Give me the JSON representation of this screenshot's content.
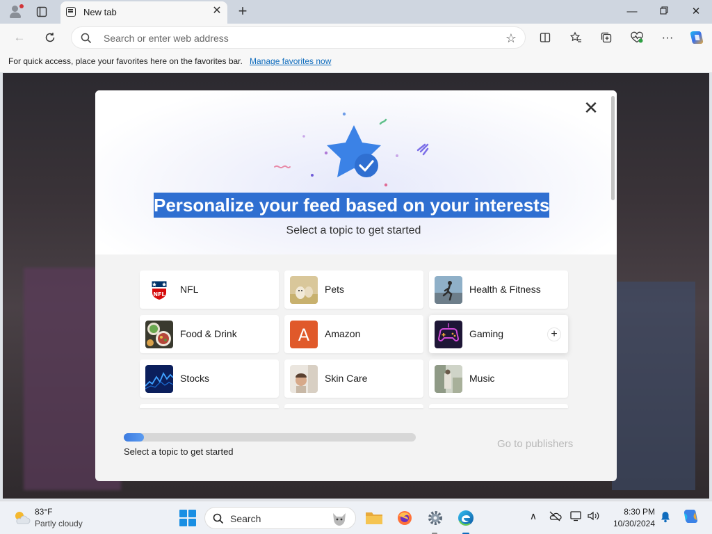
{
  "browser": {
    "tab": {
      "title": "New tab"
    },
    "address_bar": {
      "placeholder": "Search or enter web address"
    },
    "favorites_bar": {
      "message": "For quick access, place your favorites here on the favorites bar.",
      "link": "Manage favorites now"
    },
    "toolbar_icons": [
      "split-screen-icon",
      "favorites-icon",
      "collections-icon",
      "browser-essentials-icon",
      "more-icon",
      "copilot-icon"
    ]
  },
  "modal": {
    "title": "Personalize your feed based on your interests",
    "subtitle": "Select a topic to get started",
    "topics": [
      {
        "label": "NFL",
        "icon": "nfl-logo"
      },
      {
        "label": "Pets",
        "icon": "pets-thumbnail"
      },
      {
        "label": "Health & Fitness",
        "icon": "health-fitness-thumbnail"
      },
      {
        "label": "Food & Drink",
        "icon": "food-drink-thumbnail"
      },
      {
        "label": "Amazon",
        "icon": "amazon-a-logo"
      },
      {
        "label": "Gaming",
        "icon": "gaming-thumbnail"
      },
      {
        "label": "Stocks",
        "icon": "stocks-thumbnail"
      },
      {
        "label": "Skin Care",
        "icon": "skin-care-thumbnail"
      },
      {
        "label": "Music",
        "icon": "music-thumbnail"
      }
    ],
    "progress": {
      "fraction": 0.07,
      "label": "Select a topic to get started"
    },
    "go_button": "Go to publishers"
  },
  "taskbar": {
    "weather": {
      "temp": "83°F",
      "condition": "Partly cloudy"
    },
    "search_label": "Search",
    "time": "8:30 PM",
    "date": "10/30/2024"
  },
  "colors": {
    "accent": "#0f6cbd",
    "highlight": "#2f6fd1",
    "amazon": "#e0592a"
  }
}
